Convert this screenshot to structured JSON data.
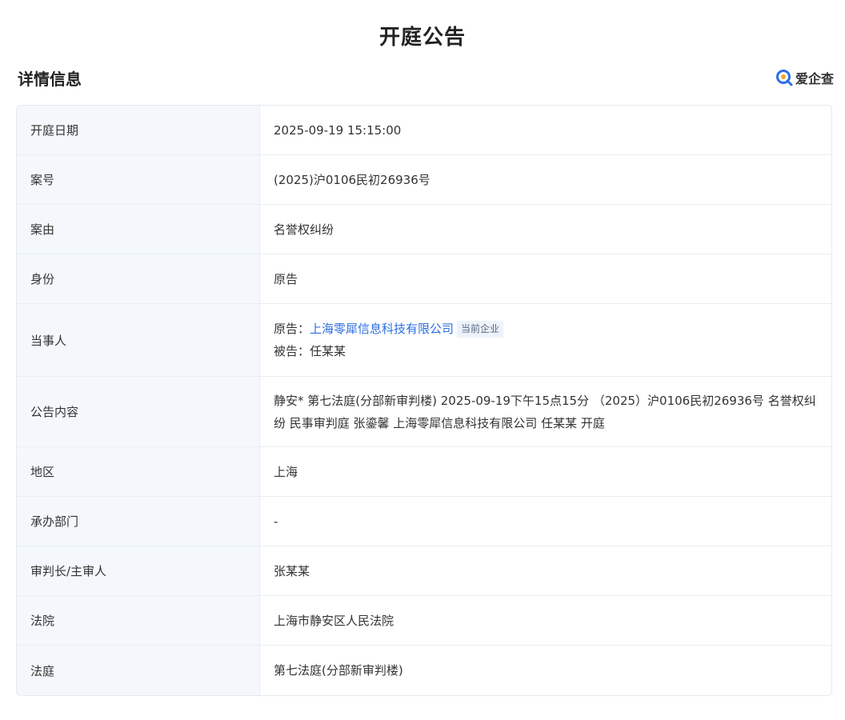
{
  "page_title": "开庭公告",
  "section_title": "详情信息",
  "brand": {
    "name": "爱企查",
    "icon": "aiqicha-logo-icon",
    "color": "#2d6fe0"
  },
  "rows": [
    {
      "label": "开庭日期",
      "value": "2025-09-19 15:15:00"
    },
    {
      "label": "案号",
      "value": "(2025)沪0106民初26936号"
    },
    {
      "label": "案由",
      "value": "名誉权纠纷"
    },
    {
      "label": "身份",
      "value": "原告"
    },
    {
      "label": "当事人"
    },
    {
      "label": "公告内容",
      "value": "静安* 第七法庭(分部新审判楼) 2025-09-19下午15点15分 （2025）沪0106民初26936号 名誉权纠纷 民事审判庭 张鎏馨 上海零犀信息科技有限公司 任某某 开庭"
    },
    {
      "label": "地区",
      "value": "上海"
    },
    {
      "label": "承办部门",
      "value": "-"
    },
    {
      "label": "审判长/主审人",
      "value": "张某某"
    },
    {
      "label": "法院",
      "value": "上海市静安区人民法院"
    },
    {
      "label": "法庭",
      "value": "第七法庭(分部新审判楼)"
    }
  ],
  "parties": {
    "plaintiff_label": "原告：",
    "plaintiff_name": "上海零犀信息科技有限公司",
    "plaintiff_tag": "当前企业",
    "defendant_label": "被告：",
    "defendant_name": "任某某"
  }
}
